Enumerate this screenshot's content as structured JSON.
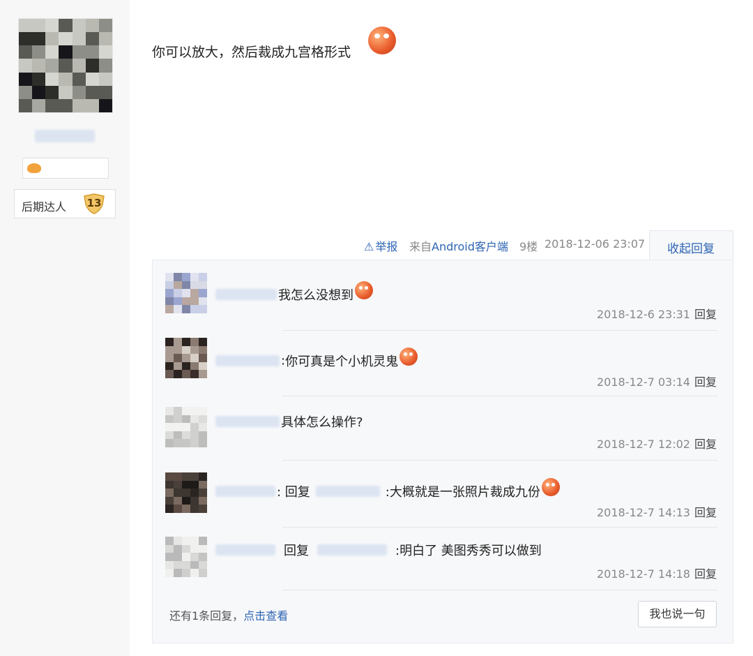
{
  "sidebar": {
    "level_title": "后期达人",
    "level_number": "13"
  },
  "post": {
    "content": "你可以放大，然后裁成九宫格形式",
    "report_label": "举报",
    "source_prefix": "来自",
    "source_client": "Android客户端",
    "floor": "9楼",
    "time": "2018-12-06 23:07",
    "collapse_label": "收起回复"
  },
  "replies": [
    {
      "prefix": "",
      "text": "我怎么没想到",
      "has_emoji": true,
      "time": "2018-12-6 23:31",
      "action": "回复"
    },
    {
      "prefix": ":",
      "text": "你可真是个小机灵鬼",
      "has_emoji": true,
      "time": "2018-12-7 03:14",
      "action": "回复"
    },
    {
      "prefix": "",
      "text": "具体怎么操作?",
      "has_emoji": false,
      "time": "2018-12-7 12:02",
      "action": "回复"
    },
    {
      "prefix": ": 回复",
      "text": ":大概就是一张照片裁成九份",
      "has_emoji": true,
      "time": "2018-12-7 14:13",
      "action": "回复"
    },
    {
      "prefix": "回复",
      "text": ":明白了 美图秀秀可以做到",
      "has_emoji": false,
      "time": "2018-12-7 14:18",
      "action": "回复"
    }
  ],
  "footer": {
    "more_prefix": "还有1条回复，",
    "more_link": "点击查看",
    "say_button": "我也说一句"
  },
  "colors": {
    "link": "#2d64b3",
    "meta": "#888888",
    "panel_bg": "#f7f8fa"
  }
}
